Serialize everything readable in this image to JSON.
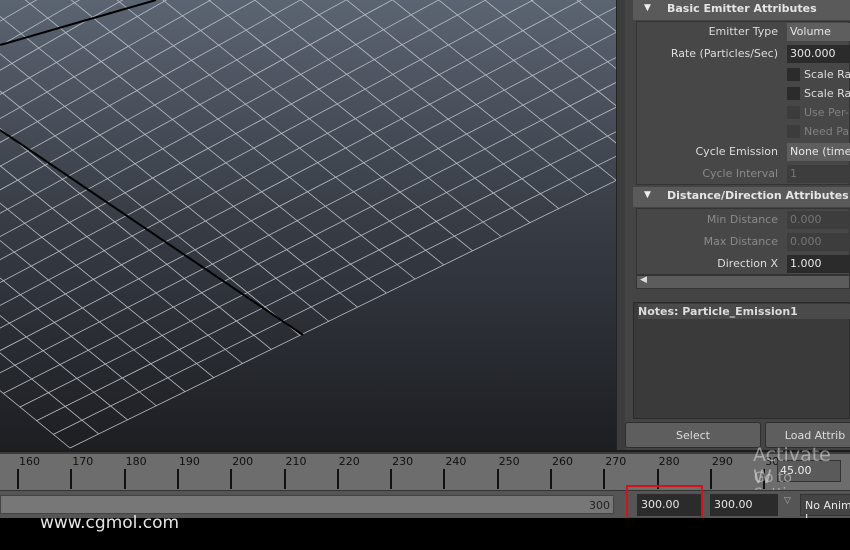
{
  "panel": {
    "basic": {
      "title": "Basic Emitter Attributes",
      "emitter_type_label": "Emitter Type",
      "emitter_type": "Volume",
      "rate_label": "Rate (Particles/Sec)",
      "rate": "300.000",
      "checkboxes": [
        {
          "label": "Scale Rat",
          "enabled": true
        },
        {
          "label": "Scale Rat",
          "enabled": true
        },
        {
          "label": "Use Per-F",
          "enabled": false
        },
        {
          "label": "Need Pare",
          "enabled": false
        }
      ],
      "cycle_emission_label": "Cycle Emission",
      "cycle_emission": "None (timeR",
      "cycle_interval_label": "Cycle Interval",
      "cycle_interval": "1"
    },
    "distance": {
      "title": "Distance/Direction Attributes",
      "min_label": "Min Distance",
      "min": "0.000",
      "max_label": "Max Distance",
      "max": "0.000",
      "dirx_label": "Direction X",
      "dirx": "1.000"
    },
    "notes_label": "Notes:  Particle_Emission1",
    "select_button": "Select",
    "load_button": "Load Attrib"
  },
  "timeline": {
    "labels": [
      "160",
      "170",
      "180",
      "190",
      "200",
      "210",
      "220",
      "230",
      "240",
      "250",
      "260",
      "270",
      "280",
      "290",
      "30"
    ],
    "current_frame": "45.00"
  },
  "range": {
    "end_label": "300",
    "start_field": "300.00",
    "end_field": "300.00",
    "anim_layer": "No Anim L"
  },
  "overlay": {
    "activate": "Activate W",
    "goto": "Go to Settings",
    "watermark": "www.cgmol.com"
  },
  "colors": {
    "highlight": "#d1141a"
  }
}
